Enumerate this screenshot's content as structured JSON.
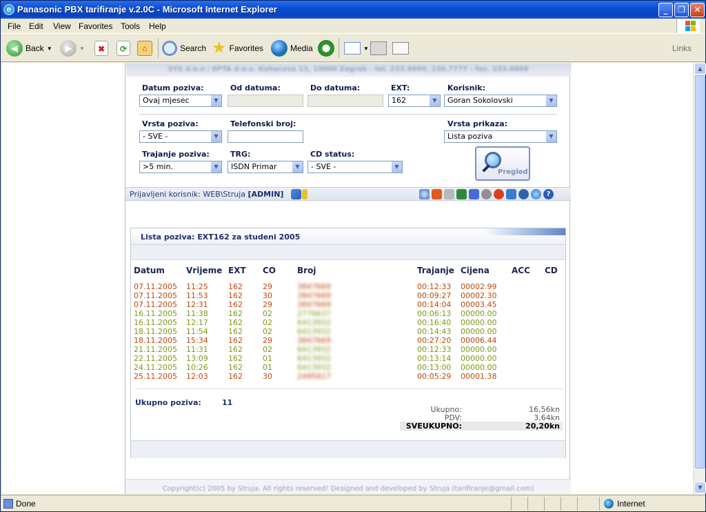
{
  "window": {
    "title": "Panasonic PBX tarifiranje v.2.0C - Microsoft Internet Explorer"
  },
  "menu": [
    "File",
    "Edit",
    "View",
    "Favorites",
    "Tools",
    "Help"
  ],
  "toolbar": {
    "back": "Back",
    "search": "Search",
    "favorites": "Favorites",
    "media": "Media",
    "links": "Links"
  },
  "header": {
    "company": "SYS d.o.o / EPTA d.o.o. Kuhaceva 13, 10000 Zagreb - tel. 233.9999, 236.7777 - fax. 233.8888"
  },
  "filters": {
    "datum_poziva": {
      "label": "Datum poziva:",
      "value": "Ovaj mjesec"
    },
    "od_datuma": {
      "label": "Od datuma:"
    },
    "do_datuma": {
      "label": "Do datuma:"
    },
    "ext": {
      "label": "EXT:",
      "value": "162"
    },
    "korisnik": {
      "label": "Korisnik:",
      "value": "Goran Sokolovski"
    },
    "vrsta_poziva": {
      "label": "Vrsta poziva:",
      "value": "- SVE -"
    },
    "telefonski_broj": {
      "label": "Telefonski broj:"
    },
    "vrsta_prikaza": {
      "label": "Vrsta prikaza:",
      "value": "Lista poziva"
    },
    "trajanje_poziva": {
      "label": "Trajanje poziva:",
      "value": ">5 min."
    },
    "trg": {
      "label": "TRG:",
      "value": "ISDN Primar"
    },
    "cd_status": {
      "label": "CD status:",
      "value": "- SVE -"
    },
    "pregled_label": "Pregled"
  },
  "userbar": {
    "prefix": "Prijavljeni korisnik: WEB\\Struja",
    "role": "[ADMIN]"
  },
  "list": {
    "title": "Lista poziva: EXT162 za studeni 2005",
    "columns": [
      "Datum",
      "Vrijeme",
      "EXT",
      "CO",
      "Broj",
      "Trajanje",
      "Cijena",
      "ACC",
      "CD"
    ],
    "rows": [
      {
        "datum": "07.11.2005",
        "vrijeme": "11:25",
        "ext": "162",
        "co": "29",
        "broj": "3847669",
        "trajanje": "00:12:33",
        "cijena": "00002.99",
        "paid": true
      },
      {
        "datum": "07.11.2005",
        "vrijeme": "11:53",
        "ext": "162",
        "co": "30",
        "broj": "3847669",
        "trajanje": "00:09:27",
        "cijena": "00002.30",
        "paid": true
      },
      {
        "datum": "07.11.2005",
        "vrijeme": "12:31",
        "ext": "162",
        "co": "29",
        "broj": "3847669",
        "trajanje": "00:14:04",
        "cijena": "00003.45",
        "paid": true
      },
      {
        "datum": "16.11.2005",
        "vrijeme": "11:38",
        "ext": "162",
        "co": "02",
        "broj": "2776637",
        "trajanje": "00:06:13",
        "cijena": "00000.00",
        "paid": false
      },
      {
        "datum": "16.11.2005",
        "vrijeme": "12:17",
        "ext": "162",
        "co": "02",
        "broj": "6413932",
        "trajanje": "00:16:40",
        "cijena": "00000.00",
        "paid": false
      },
      {
        "datum": "18.11.2005",
        "vrijeme": "11:54",
        "ext": "162",
        "co": "02",
        "broj": "6413932",
        "trajanje": "00:14:43",
        "cijena": "00000.00",
        "paid": false
      },
      {
        "datum": "18.11.2005",
        "vrijeme": "15:34",
        "ext": "162",
        "co": "29",
        "broj": "3847669",
        "trajanje": "00:27:20",
        "cijena": "00006.44",
        "paid": true
      },
      {
        "datum": "21.11.2005",
        "vrijeme": "11:31",
        "ext": "162",
        "co": "02",
        "broj": "6413932",
        "trajanje": "00:12:33",
        "cijena": "00000.00",
        "paid": false
      },
      {
        "datum": "22.11.2005",
        "vrijeme": "13:09",
        "ext": "162",
        "co": "01",
        "broj": "6413932",
        "trajanje": "00:13:14",
        "cijena": "00000.00",
        "paid": false
      },
      {
        "datum": "24.11.2005",
        "vrijeme": "10:26",
        "ext": "162",
        "co": "01",
        "broj": "6413932",
        "trajanje": "00:13:00",
        "cijena": "00000.00",
        "paid": false
      },
      {
        "datum": "25.11.2005",
        "vrijeme": "12:03",
        "ext": "162",
        "co": "30",
        "broj": "2495617",
        "trajanje": "00:05:29",
        "cijena": "00001.38",
        "paid": true
      }
    ],
    "ukupno_poziva_label": "Ukupno poziva:",
    "ukupno_poziva": "11",
    "totals": [
      {
        "label": "Ukupno:",
        "value": "16,56kn"
      },
      {
        "label": "PDV:",
        "value": "3,64kn"
      },
      {
        "label": "SVEUKUPNO:",
        "value": "20,20kn"
      }
    ]
  },
  "footer": {
    "copyright": "Copyright(c) 2005 by Struja. All rights reserved! Designed and developed by Struja (tarifiranje@gmail.com)"
  },
  "status": {
    "text": "Done",
    "zone": "Internet"
  },
  "colors": {
    "paid_row": "#c0480e",
    "free_row": "#7a9a14",
    "label": "#0f1c4c"
  }
}
